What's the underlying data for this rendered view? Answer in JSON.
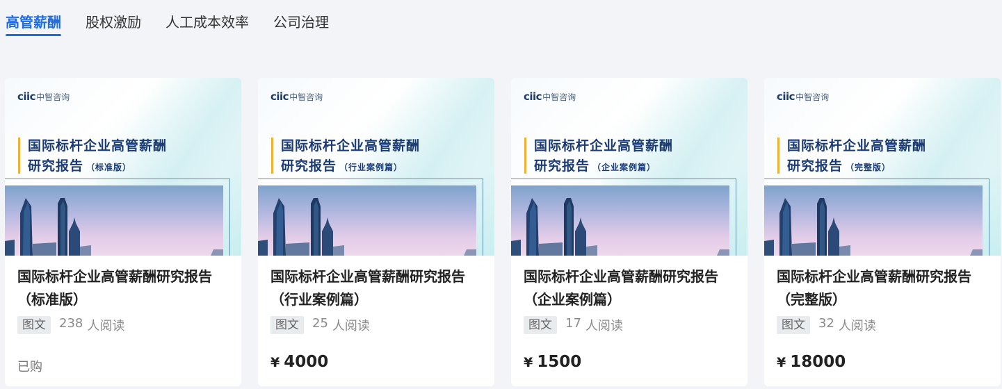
{
  "tabs": [
    {
      "label": "高管薪酬",
      "active": true
    },
    {
      "label": "股权激励",
      "active": false
    },
    {
      "label": "人工成本效率",
      "active": false
    },
    {
      "label": "公司治理",
      "active": false
    }
  ],
  "logo": {
    "mark": "ciic",
    "text": "中智咨询"
  },
  "cards": [
    {
      "cover_line1": "国际标杆企业高管薪酬",
      "cover_line2": "研究报告",
      "cover_sub": "（标准版）",
      "title": "国际标杆企业高管薪酬研究报告\n（标准版）",
      "tag": "图文",
      "reads": "238",
      "reads_suffix": "人阅读",
      "status": "已购",
      "currency": "",
      "price": ""
    },
    {
      "cover_line1": "国际标杆企业高管薪酬",
      "cover_line2": "研究报告",
      "cover_sub": "（行业案例篇）",
      "title": "国际标杆企业高管薪酬研究报告\n（行业案例篇）",
      "tag": "图文",
      "reads": "25",
      "reads_suffix": "人阅读",
      "status": "",
      "currency": "¥",
      "price": "4000"
    },
    {
      "cover_line1": "国际标杆企业高管薪酬",
      "cover_line2": "研究报告",
      "cover_sub": "（企业案例篇）",
      "title": "国际标杆企业高管薪酬研究报告\n（企业案例篇）",
      "tag": "图文",
      "reads": "17",
      "reads_suffix": "人阅读",
      "status": "",
      "currency": "¥",
      "price": "1500"
    },
    {
      "cover_line1": "国际标杆企业高管薪酬",
      "cover_line2": "研究报告",
      "cover_sub": "（完整版）",
      "title": "国际标杆企业高管薪酬研究报告\n（完整版）",
      "tag": "图文",
      "reads": "32",
      "reads_suffix": "人阅读",
      "status": "",
      "currency": "¥",
      "price": "18000"
    }
  ],
  "colors": {
    "accent": "#1f6ce0",
    "cover_title": "#1a3b75",
    "cover_bar": "#f0b232"
  }
}
